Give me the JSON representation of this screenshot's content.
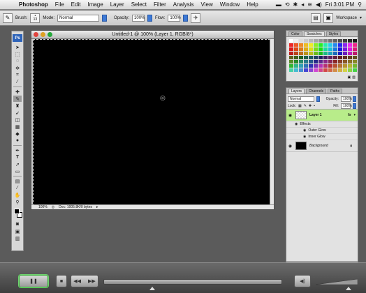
{
  "menubar": {
    "app": "Photoshop",
    "items": [
      "File",
      "Edit",
      "Image",
      "Layer",
      "Select",
      "Filter",
      "Analysis",
      "View",
      "Window",
      "Help"
    ],
    "clock": "Fri 3:01 PM"
  },
  "options": {
    "brush_label": "Brush:",
    "brush_size": "13",
    "mode_label": "Mode:",
    "mode_value": "Normal",
    "opacity_label": "Opacity:",
    "opacity_value": "100%",
    "flow_label": "Flow:",
    "flow_value": "100%",
    "workspace_label": "Workspace"
  },
  "tools": {
    "ps_logo": "Ps"
  },
  "document": {
    "title": "Untitled-1 @ 100% (Layer 1, RGB/8*)",
    "zoom": "100%",
    "doc_info": "Doc: 1005.8K/0 bytes"
  },
  "swatches_panel": {
    "tabs": [
      "Color",
      "Swatches",
      "Styles"
    ],
    "active_tab": "Swatches"
  },
  "layers_panel": {
    "tabs": [
      "Layers",
      "Channels",
      "Paths"
    ],
    "active_tab": "Layers",
    "blend_mode": "Normal",
    "opacity_label": "Opacity:",
    "opacity_value": "100%",
    "lock_label": "Lock:",
    "fill_label": "Fill:",
    "fill_value": "100%",
    "layers": [
      {
        "name": "Layer 1",
        "selected": true,
        "fx": "fx"
      },
      {
        "name": "Background",
        "selected": false
      }
    ],
    "effects_label": "Effects",
    "effects": [
      "Outer Glow",
      "Inner Glow"
    ]
  },
  "player": {
    "play_icon": "pause-icon",
    "seek_progress": 0.27,
    "volume_level": 0.73
  }
}
